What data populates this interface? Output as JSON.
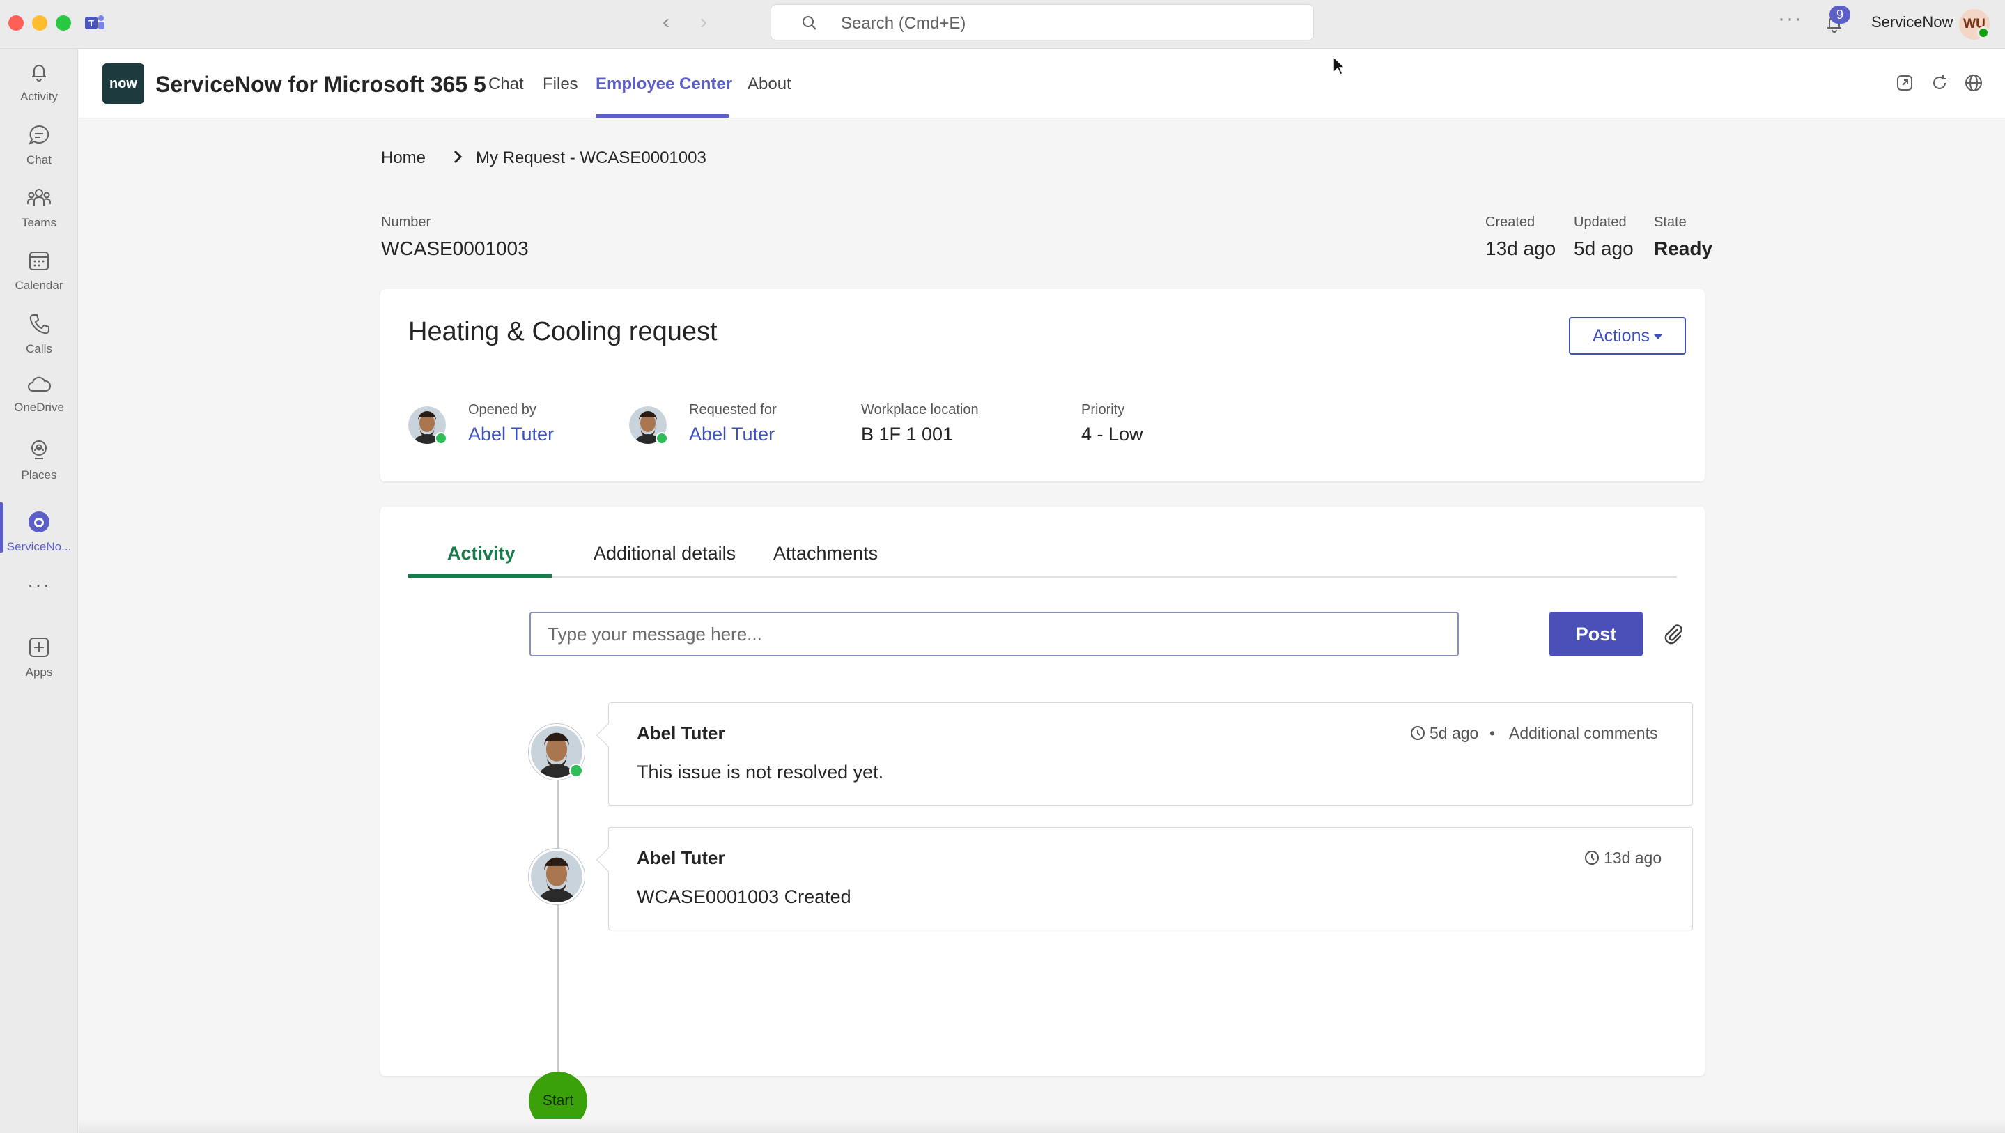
{
  "titlebar": {
    "search_placeholder": "Search (Cmd+E)",
    "more_label": "···",
    "notification_count": "9",
    "org_name": "ServiceNow",
    "user_initials": "WU"
  },
  "rail": {
    "items": [
      {
        "label": "Activity",
        "icon": "bell-icon"
      },
      {
        "label": "Chat",
        "icon": "chat-icon"
      },
      {
        "label": "Teams",
        "icon": "teams-icon"
      },
      {
        "label": "Calendar",
        "icon": "calendar-icon"
      },
      {
        "label": "Calls",
        "icon": "phone-icon"
      },
      {
        "label": "OneDrive",
        "icon": "cloud-icon"
      },
      {
        "label": "Places",
        "icon": "places-icon"
      },
      {
        "label": "ServiceNo...",
        "icon": "servicenow-icon"
      },
      {
        "label": "Apps",
        "icon": "add-app-icon"
      }
    ],
    "more_label": "···"
  },
  "app": {
    "logo_text": "now",
    "title": "ServiceNow for Microsoft 365 5",
    "tabs": [
      {
        "label": "Chat"
      },
      {
        "label": "Files"
      },
      {
        "label": "Employee Center"
      },
      {
        "label": "About"
      }
    ],
    "active_tab": "Employee Center"
  },
  "breadcrumb": {
    "home": "Home",
    "current": "My Request - WCASE0001003"
  },
  "record": {
    "number_label": "Number",
    "number": "WCASE0001003",
    "created_label": "Created",
    "created": "13d ago",
    "updated_label": "Updated",
    "updated": "5d ago",
    "state_label": "State",
    "state": "Ready"
  },
  "summary": {
    "title": "Heating & Cooling request",
    "actions_label": "Actions",
    "opened_by_label": "Opened by",
    "opened_by": "Abel Tuter",
    "requested_for_label": "Requested for",
    "requested_for": "Abel Tuter",
    "location_label": "Workplace location",
    "location": "B 1F 1 001",
    "priority_label": "Priority",
    "priority": "4 - Low"
  },
  "activity": {
    "tabs": [
      {
        "label": "Activity"
      },
      {
        "label": "Additional details"
      },
      {
        "label": "Attachments"
      }
    ],
    "message_placeholder": "Type your message here...",
    "post_label": "Post",
    "entries": [
      {
        "author": "Abel Tuter",
        "time": "5d ago",
        "separator": "•",
        "type": "Additional comments",
        "body": "This issue is not resolved yet."
      },
      {
        "author": "Abel Tuter",
        "time": "13d ago",
        "body": "WCASE0001003 Created"
      }
    ],
    "start_label": "Start"
  },
  "colors": {
    "brand": "#5b5fc7",
    "link": "#3d4fbb",
    "activity_green": "#1b7a4a",
    "start_green": "#3aa10a",
    "presence_green": "#2ebd59"
  }
}
